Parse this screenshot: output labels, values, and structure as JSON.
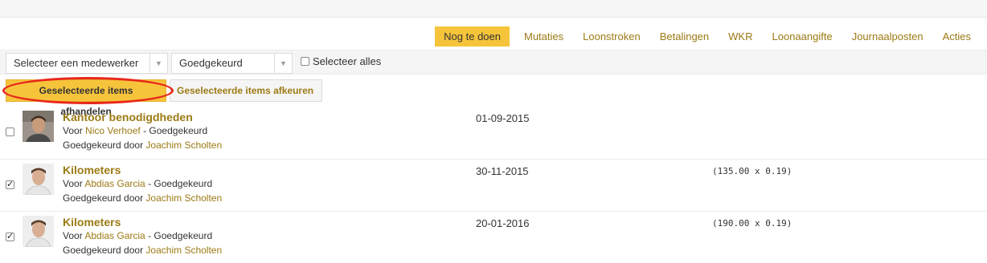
{
  "tabs": [
    "Nog te doen",
    "Mutaties",
    "Loonstroken",
    "Betalingen",
    "WKR",
    "Loonaangifte",
    "Journaalposten",
    "Acties"
  ],
  "filters": {
    "employee_select": "Selecteer een medewerker",
    "status_select": "Goedgekeurd",
    "select_all_label": "Selecteer alles",
    "select_all_checked": false
  },
  "actions": {
    "approve_label": "Geselecteerde items afhandelen",
    "reject_label": "Geselecteerde items afkeuren"
  },
  "colors": {
    "accent": "#f6c43b",
    "link": "#9c7a14",
    "highlight": "#e8281a"
  },
  "items": [
    {
      "title": "Kantoor benodigdheden",
      "for_prefix": "Voor",
      "employee": "Nico Verhoef",
      "status_suffix": "- Goedgekeurd",
      "approved_by_prefix": "Goedgekeurd door",
      "approver": "Joachim Scholten",
      "date": "01-09-2015",
      "calculation": "",
      "checked": false
    },
    {
      "title": "Kilometers",
      "for_prefix": "Voor",
      "employee": "Abdias Garcia",
      "status_suffix": "- Goedgekeurd",
      "approved_by_prefix": "Goedgekeurd door",
      "approver": "Joachim Scholten",
      "date": "30-11-2015",
      "calculation": "(135.00 x 0.19)",
      "checked": true
    },
    {
      "title": "Kilometers",
      "for_prefix": "Voor",
      "employee": "Abdias Garcia",
      "status_suffix": "- Goedgekeurd",
      "approved_by_prefix": "Goedgekeurd door",
      "approver": "Joachim Scholten",
      "date": "20-01-2016",
      "calculation": "(190.00 x 0.19)",
      "checked": true
    }
  ]
}
